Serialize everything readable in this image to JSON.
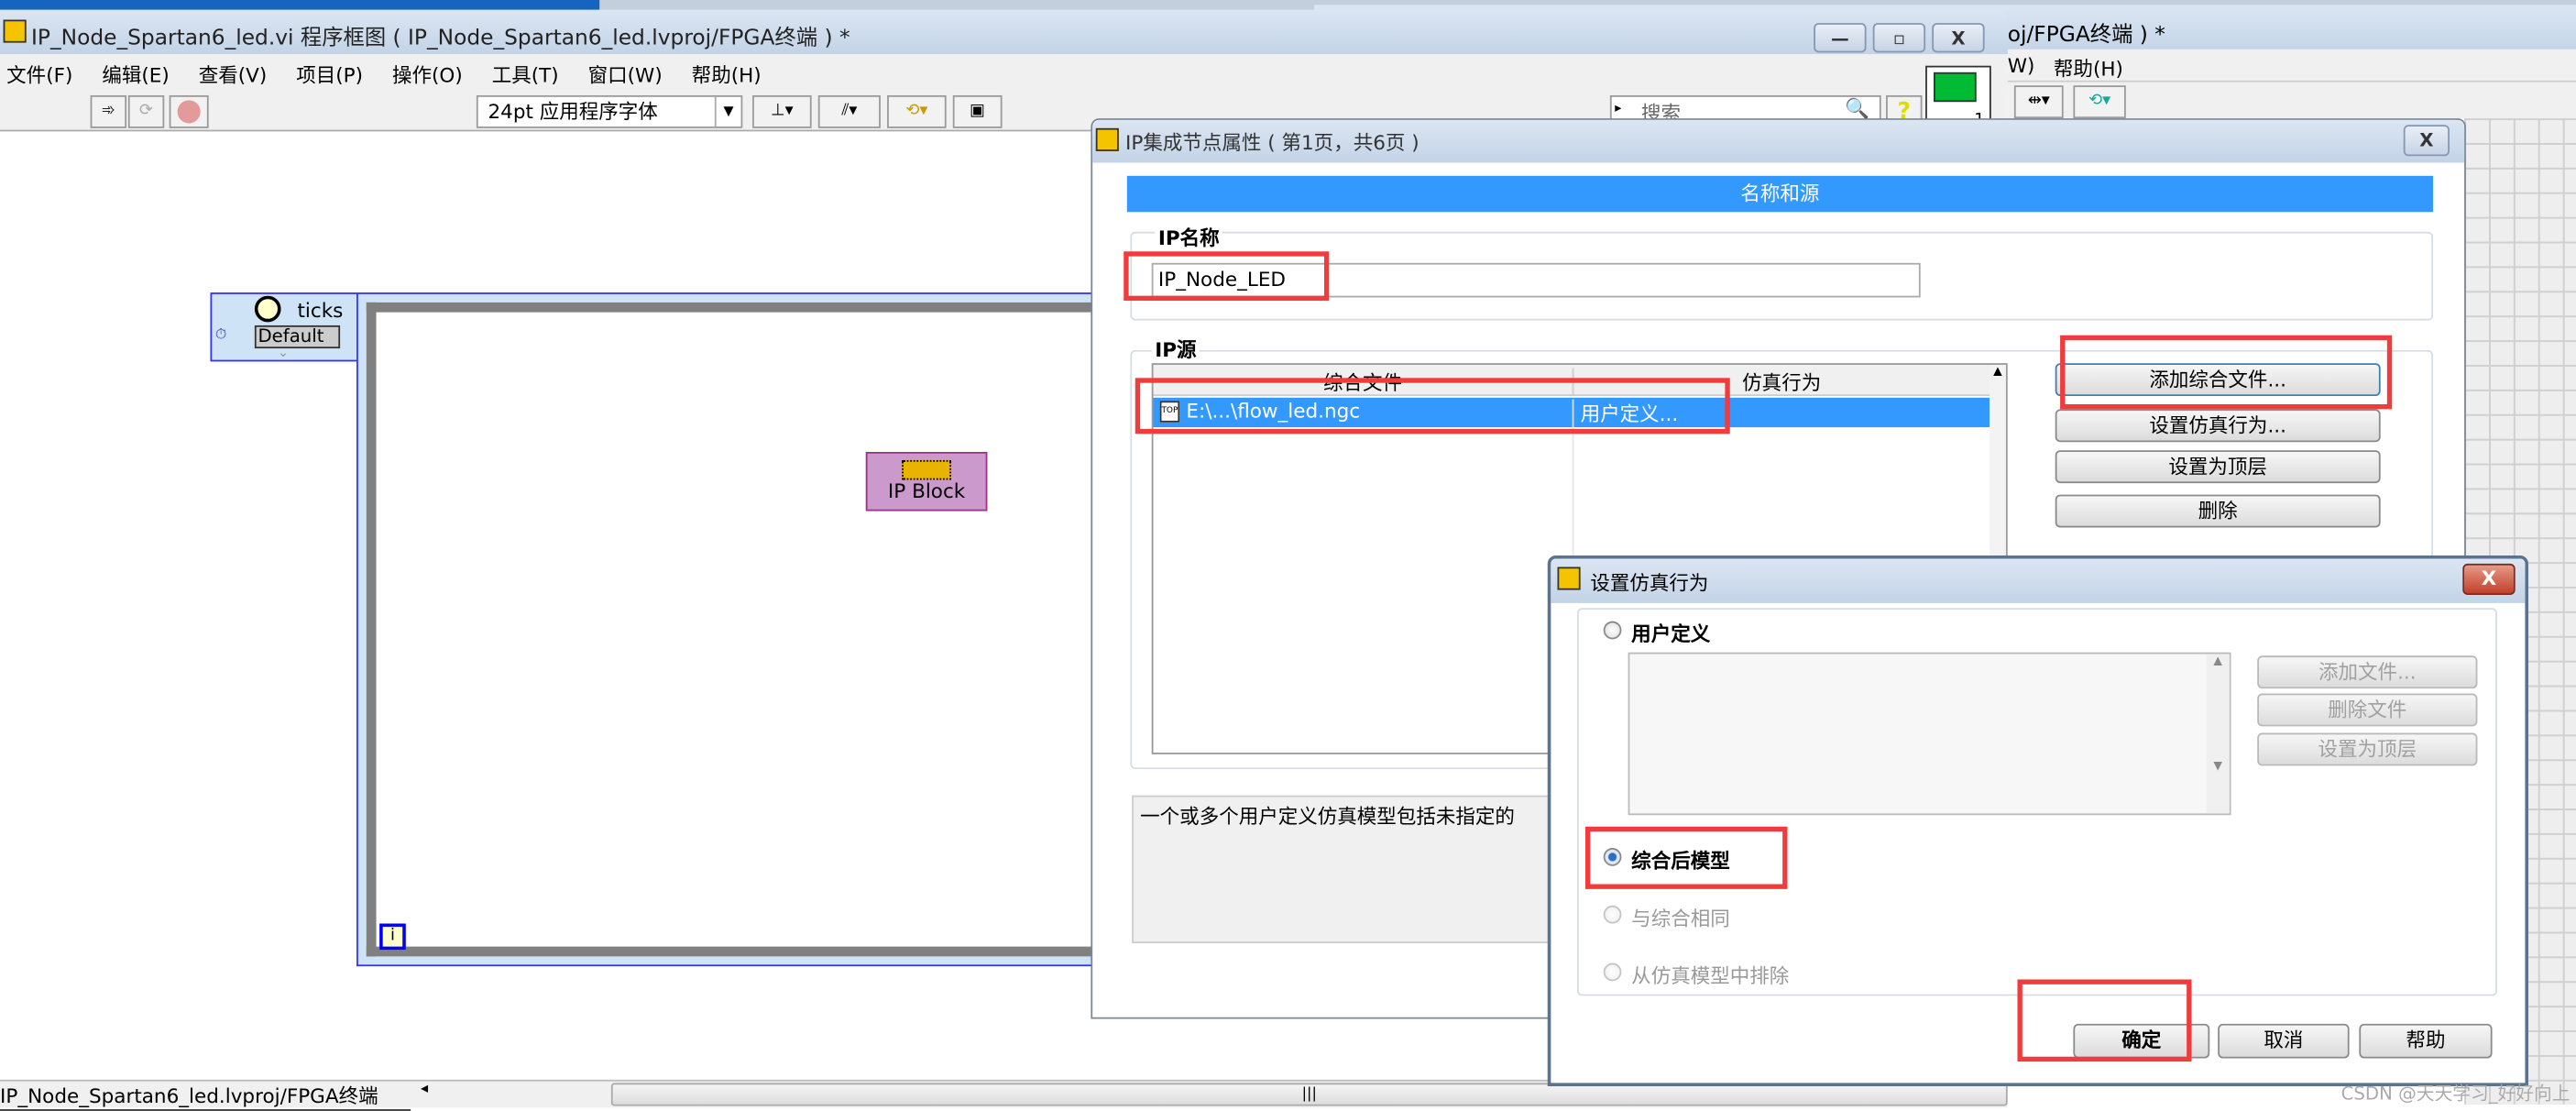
{
  "back_window": {
    "title_fragment": "oj/FPGA终端 ) *",
    "menu_fragment": "W)",
    "menu_help": "帮助(H)"
  },
  "main_window": {
    "title": "IP_Node_Spartan6_led.vi 程序框图 ( IP_Node_Spartan6_led.lvproj/FPGA终端 ) *",
    "menu": [
      "文件(F)",
      "编辑(E)",
      "查看(V)",
      "项目(P)",
      "操作(O)",
      "工具(T)",
      "窗口(W)",
      "帮助(H)"
    ],
    "toolbar": {
      "font_select": "24pt 应用程序字体",
      "search_placeholder": "搜索"
    },
    "diagram": {
      "timed_loop_source": "ticks",
      "timed_loop_mode": "Default",
      "iteration_terminal": "i",
      "ip_block_label": "IP Block"
    },
    "status_path": "IP_Node_Spartan6_led.lvproj/FPGA终端",
    "icon_pane_number": "1"
  },
  "ip_dialog": {
    "title": "IP集成节点属性 ( 第1页，共6页 )",
    "section_header": "名称和源",
    "ip_name_label": "IP名称",
    "ip_name_value": "IP_Node_LED",
    "ip_source_label": "IP源",
    "table": {
      "columns": [
        "综合文件",
        "仿真行为"
      ],
      "rows": [
        {
          "file": "E:\\...\\flow_led.ngc",
          "behavior": "用户定义..."
        }
      ]
    },
    "buttons": {
      "add_synthesis_file": "添加综合文件...",
      "set_sim_behavior": "设置仿真行为...",
      "set_top": "设置为顶层",
      "delete": "删除"
    },
    "description": "一个或多个用户定义仿真模型包括未指定的"
  },
  "sim_dialog": {
    "title": "设置仿真行为",
    "options": {
      "user_defined": "用户定义",
      "post_synthesis": "综合后模型",
      "same_as_synthesis": "与综合相同",
      "exclude": "从仿真模型中排除"
    },
    "selected_option": "综合后模型",
    "file_buttons": {
      "add_file": "添加文件...",
      "delete_file": "删除文件",
      "set_top": "设置为顶层"
    },
    "buttons": {
      "ok": "确定",
      "cancel": "取消",
      "help": "帮助"
    }
  },
  "watermark": "CSDN @天天学习_好好向上",
  "colors": {
    "selection": "#3399ff",
    "highlight_box": "#f03c3c",
    "ip_block": "#cc99cc",
    "loop_border": "#3333ff"
  }
}
